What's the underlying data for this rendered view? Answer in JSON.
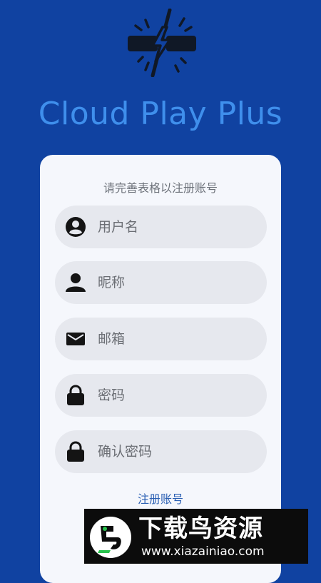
{
  "app": {
    "title": "Cloud Play Plus",
    "logo_icon": "broken-lightning-icon"
  },
  "form": {
    "hint": "请完善表格以注册账号",
    "fields": [
      {
        "id": "username",
        "icon": "account-circle-icon",
        "placeholder": "用户名",
        "value": ""
      },
      {
        "id": "nickname",
        "icon": "person-icon",
        "placeholder": "昵称",
        "value": ""
      },
      {
        "id": "email",
        "icon": "mail-icon",
        "placeholder": "邮箱",
        "value": ""
      },
      {
        "id": "password",
        "icon": "lock-icon",
        "placeholder": "密码",
        "value": ""
      },
      {
        "id": "confirm_password",
        "icon": "lock-icon",
        "placeholder": "确认密码",
        "value": ""
      }
    ],
    "register_label": "注册账号"
  },
  "watermark": {
    "title": "下载鸟资源",
    "url": "www.xiazainiao.com"
  },
  "colors": {
    "background": "#1042a1",
    "title": "#3f8fec",
    "card": "#f5f7fc",
    "field": "#e6e8ee",
    "link": "#2a5fb3"
  }
}
